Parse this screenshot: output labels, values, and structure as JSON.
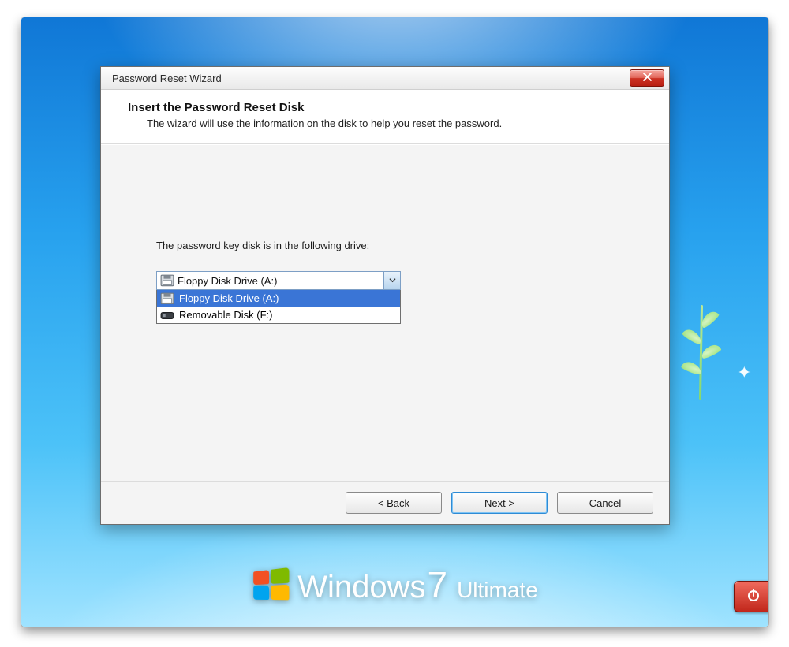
{
  "dialog": {
    "title": "Password Reset Wizard",
    "header_title": "Insert the Password Reset Disk",
    "header_sub": "The wizard will use the information on the disk to help you reset the password.",
    "prompt": "The password key disk is in the following drive:",
    "selected_drive": "Floppy Disk Drive (A:)",
    "drive_options": [
      {
        "label": "Floppy Disk Drive (A:)",
        "icon": "floppy",
        "selected": true
      },
      {
        "label": "Removable Disk (F:)",
        "icon": "removable",
        "selected": false
      }
    ],
    "buttons": {
      "back": "< Back",
      "next": "Next >",
      "cancel": "Cancel"
    }
  },
  "branding": {
    "windows": "Windows",
    "seven": "7",
    "edition": "Ultimate"
  }
}
